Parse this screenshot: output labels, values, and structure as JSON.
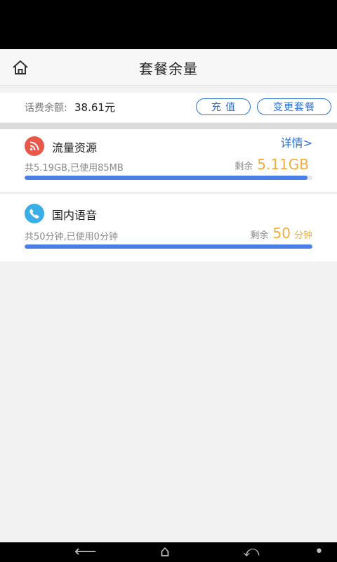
{
  "header": {
    "title": "套餐余量",
    "home_icon": "home-icon"
  },
  "balance": {
    "label": "话费余额:",
    "value": "38.61元",
    "recharge_label": "充值",
    "change_plan_label": "变更套餐"
  },
  "data_card": {
    "icon": "rss-icon",
    "icon_color": "#e8584a",
    "title": "流量资源",
    "detail_link": "详情>",
    "usage": "共5.19GB,已使用85MB",
    "remain_label": "剩余",
    "remain_amount": "5.11GB",
    "remain_unit": "",
    "used_fraction": 0.984
  },
  "voice_card": {
    "icon": "phone-icon",
    "icon_color": "#3aaee6",
    "title": "国内语音",
    "usage": "共50分钟,已使用0分钟",
    "remain_label": "剩余",
    "remain_amount": "50",
    "remain_unit": "分钟",
    "used_fraction": 1.0
  },
  "colors": {
    "accent": "#2a6fd4",
    "highlight": "#f2ae3a",
    "progress": "#4a7fe8"
  }
}
